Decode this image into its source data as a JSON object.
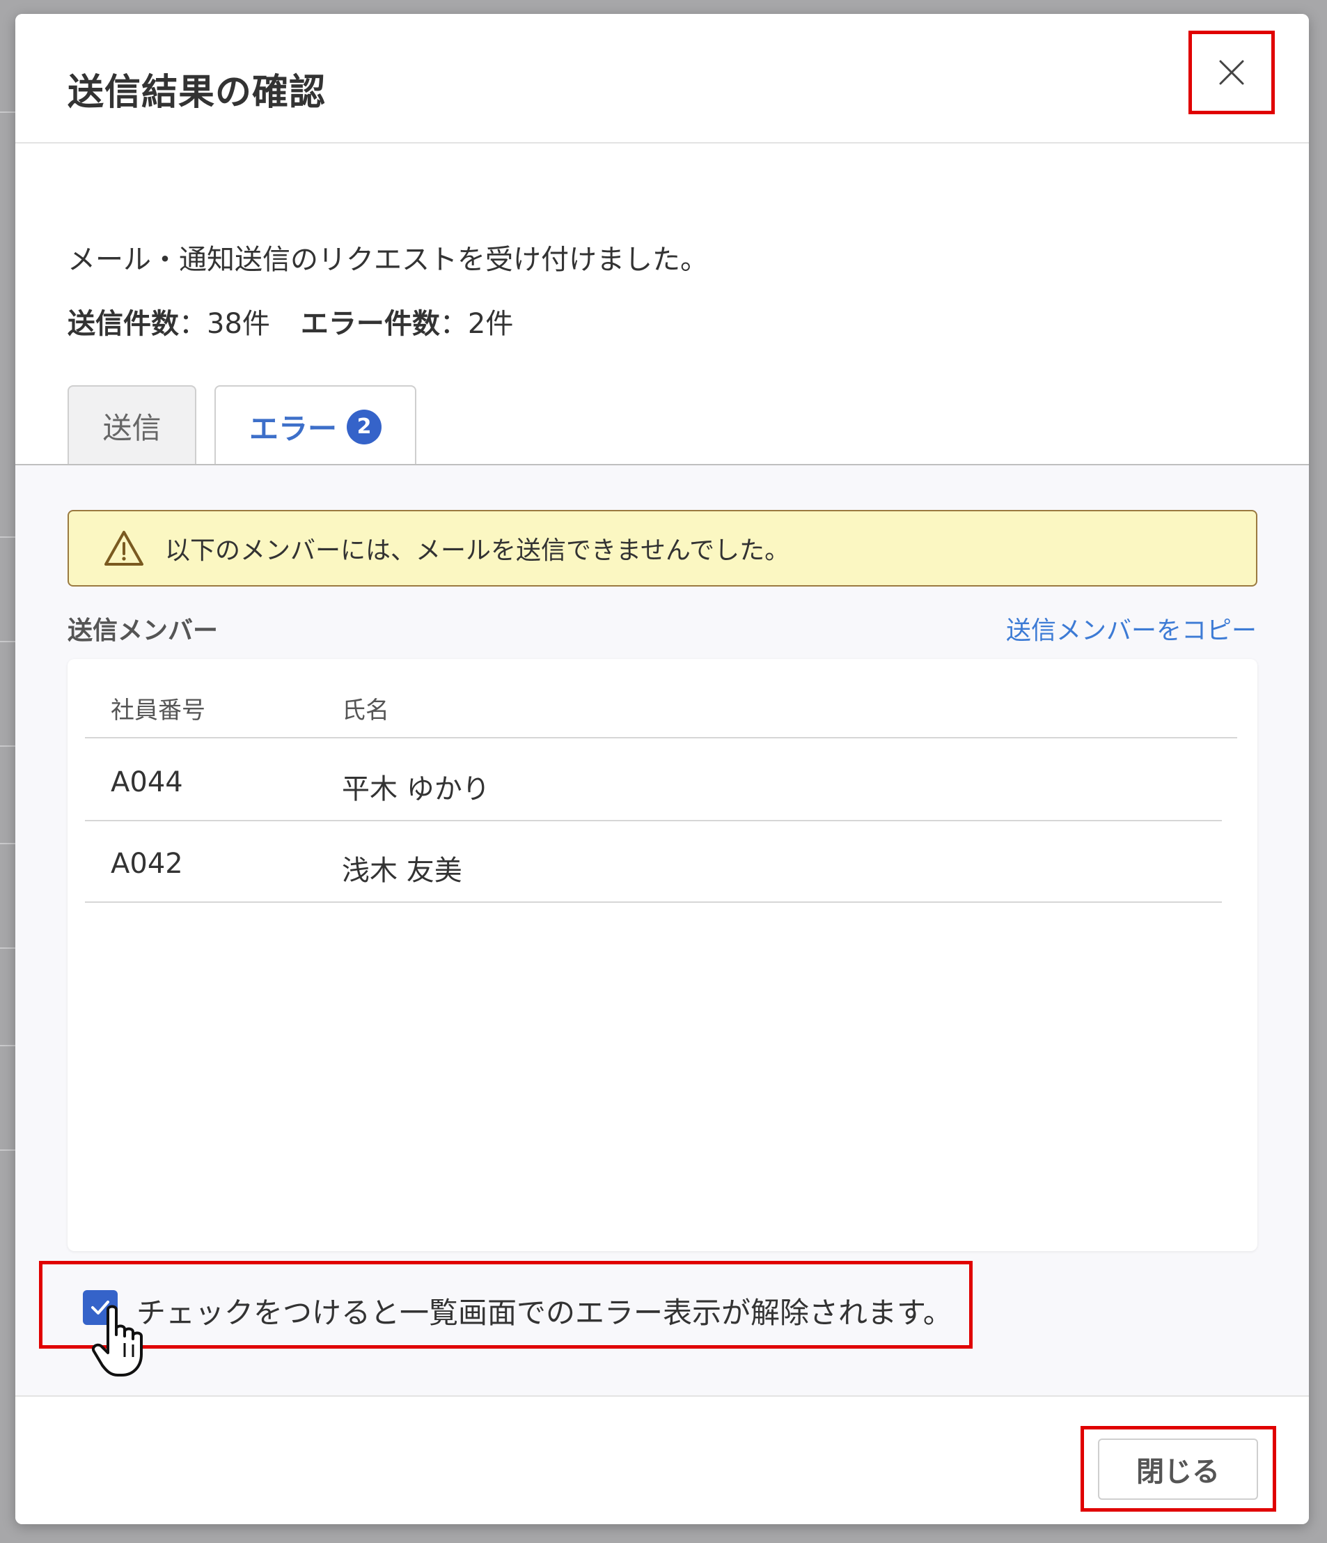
{
  "dialog": {
    "title": "送信結果の確認",
    "close_icon": "close-icon"
  },
  "summary": {
    "message": "メール・通知送信のリクエストを受け付けました。",
    "sent_label": "送信件数",
    "sent_value": "：38件",
    "error_label": "エラー件数",
    "error_value": "：2件"
  },
  "tabs": [
    {
      "label": "送信",
      "active": false
    },
    {
      "label": "エラー",
      "active": true,
      "badge": "2"
    }
  ],
  "warning": {
    "icon": "warning-icon",
    "text": "以下のメンバーには、メールを送信できませんでした。"
  },
  "members": {
    "section_label": "送信メンバー",
    "copy_link": "送信メンバーをコピー",
    "columns": [
      "社員番号",
      "氏名"
    ],
    "rows": [
      {
        "id": "A044",
        "name": "平木 ゆかり"
      },
      {
        "id": "A042",
        "name": "浅木 友美"
      }
    ]
  },
  "checkbox": {
    "checked": true,
    "label": "チェックをつけると一覧画面でのエラー表示が解除されます。"
  },
  "footer": {
    "close_label": "閉じる"
  },
  "colors": {
    "accent": "#3563c9",
    "link": "#3d7bd5",
    "highlight": "#e00000",
    "warning_bg": "#fbf7c2"
  }
}
